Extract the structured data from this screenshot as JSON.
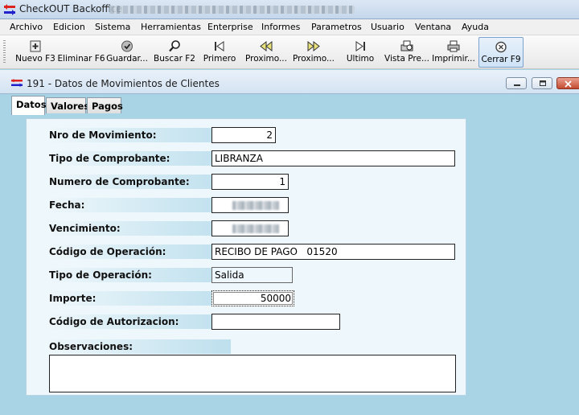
{
  "app": {
    "title": "CheckOUT Backoffice"
  },
  "menu": [
    {
      "label": "Archivo"
    },
    {
      "label": "Edicion"
    },
    {
      "label": "Sistema"
    },
    {
      "label": "Herramientas"
    },
    {
      "label": "Enterprise"
    },
    {
      "label": "Informes"
    },
    {
      "label": "Parametros"
    },
    {
      "label": "Usuario"
    },
    {
      "label": "Ventana"
    },
    {
      "label": "Ayuda"
    }
  ],
  "toolbar": {
    "buttons": [
      {
        "label": "Nuevo F3",
        "icon": "new-icon"
      },
      {
        "label": "Eliminar F6",
        "icon": "delete-icon"
      },
      {
        "label": "Guardar...",
        "icon": "save-icon"
      },
      {
        "label": "Buscar F2",
        "icon": "search-icon"
      },
      {
        "label": "Primero",
        "icon": "first-icon"
      },
      {
        "label": "Proximo...",
        "icon": "previous-icon"
      },
      {
        "label": "Proximo...",
        "icon": "next-icon"
      },
      {
        "label": "Ultimo",
        "icon": "last-icon"
      },
      {
        "label": "Vista Pre...",
        "icon": "preview-icon"
      },
      {
        "label": "Imprimir...",
        "icon": "print-icon"
      },
      {
        "label": "Cerrar F9",
        "icon": "close-icon"
      }
    ]
  },
  "window": {
    "title": "191 - Datos de Movimientos de Clientes"
  },
  "tabs": [
    {
      "label": "Datos"
    },
    {
      "label": "Valores"
    },
    {
      "label": "Pagos"
    }
  ],
  "form": {
    "nro_movimiento": {
      "label": "Nro de Movimiento:",
      "value": "2"
    },
    "tipo_comprobante": {
      "label": "Tipo de Comprobante:",
      "value": "LIBRANZA"
    },
    "numero_comprobante": {
      "label": "Numero de Comprobante:",
      "value": "1"
    },
    "fecha": {
      "label": "Fecha:",
      "value": ""
    },
    "vencimiento": {
      "label": "Vencimiento:",
      "value": ""
    },
    "codigo_operacion": {
      "label": "Código de Operación:",
      "value": "RECIBO DE PAGO   01520"
    },
    "tipo_operacion": {
      "label": "Tipo de Operación:",
      "value": "Salida"
    },
    "importe": {
      "label": "Importe:",
      "value": "50000"
    },
    "codigo_autorizacion": {
      "label": "Código de Autorizacion:",
      "value": ""
    },
    "observaciones": {
      "label": "Observaciones:",
      "value": ""
    }
  },
  "colors": {
    "background": "#a8d4e6",
    "panel": "#eef7fb",
    "accent": "#7da2ce"
  }
}
